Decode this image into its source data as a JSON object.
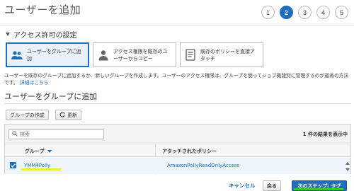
{
  "page": {
    "title": "ユーザーを追加"
  },
  "steps": [
    "1",
    "2",
    "3",
    "4",
    "5"
  ],
  "active_step": "2",
  "permissions": {
    "section_title": "アクセス許可の設定",
    "options": [
      {
        "label": "ユーザーをグループに追加",
        "icon": "users-group-icon",
        "selected": true
      },
      {
        "label": "アクセス権限を既存のユーザーからコピー",
        "icon": "user-icon",
        "selected": false
      },
      {
        "label": "既存のポリシーを直接アタッチ",
        "icon": "document-icon",
        "selected": false
      }
    ],
    "description": "ユーザーを既存のグループに追加するか、新しいグループを作成します。ユーザーのアクセス権限は、グループを使ってジョブ機能別に管理するのが最善の方法です。",
    "details_link": "詳細はこちら"
  },
  "group_section": {
    "title": "ユーザーをグループに追加",
    "create_group_button": "グループの作成",
    "refresh_button": "更新",
    "search_placeholder": "検索",
    "result_count": "1 件の結果を表示中",
    "columns": {
      "group": "グループ",
      "attached_policy": "アタッチされたポリシー"
    },
    "rows": [
      {
        "group": "YMM4Polly",
        "policy": "AmazonPollyReadOnlyAccess",
        "checked": true
      }
    ]
  },
  "footer": {
    "cancel": "キャンセル",
    "back": "戻る",
    "next": "次のステップ: タグ"
  },
  "colors": {
    "accent": "#1f6ec0",
    "link": "#1a6fc1",
    "highlight": "#f2ef1e",
    "underline": "#39c437"
  }
}
